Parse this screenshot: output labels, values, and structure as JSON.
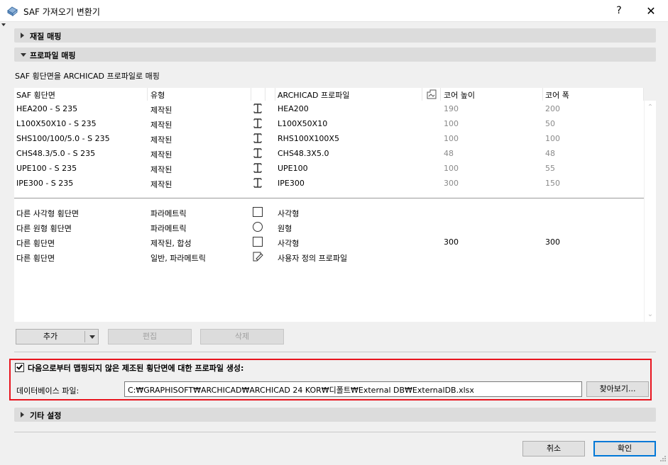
{
  "window": {
    "title": "SAF 가져오기 변환기",
    "help": "?",
    "close": "✕"
  },
  "sections": {
    "material": "재질 매핑",
    "profile": "프로파일 매핑",
    "other": "기타 설정"
  },
  "profile": {
    "subtitle": "SAF 횡단면을 ARCHICAD 프로파일로 매핑",
    "headers": [
      "SAF 횡단면",
      "유형",
      "ARCHICAD 프로파일",
      "코어 높이",
      "코어 폭"
    ],
    "rows": [
      {
        "saf": "HEA200 - S 235",
        "type": "제작된",
        "icon": "i-beam-icon",
        "archicad": "HEA200",
        "h": "190",
        "w": "200"
      },
      {
        "saf": "L100X50X10 - S 235",
        "type": "제작된",
        "icon": "i-beam-icon",
        "archicad": "L100X50X10",
        "h": "100",
        "w": "50"
      },
      {
        "saf": "SHS100/100/5.0 - S 235",
        "type": "제작된",
        "icon": "i-beam-icon",
        "archicad": "RHS100X100X5",
        "h": "100",
        "w": "100"
      },
      {
        "saf": "CHS48.3/5.0 - S 235",
        "type": "제작된",
        "icon": "i-beam-icon",
        "archicad": "CHS48.3X5.0",
        "h": "48",
        "w": "48"
      },
      {
        "saf": "UPE100 - S 235",
        "type": "제작된",
        "icon": "i-beam-icon",
        "archicad": "UPE100",
        "h": "100",
        "w": "55"
      },
      {
        "saf": "IPE300 - S 235",
        "type": "제작된",
        "icon": "i-beam-icon",
        "archicad": "IPE300",
        "h": "300",
        "w": "150"
      }
    ],
    "other_rows": [
      {
        "saf": "다른 사각형 횡단면",
        "type": "파라메트릭",
        "icon": "rectangle-icon",
        "archicad": "사각형",
        "h": "",
        "w": ""
      },
      {
        "saf": "다른 원형 횡단면",
        "type": "파라메트릭",
        "icon": "circle-icon",
        "archicad": "원형",
        "h": "",
        "w": ""
      },
      {
        "saf": "다른 횡단면",
        "type": "제작된, 합성",
        "icon": "rectangle-icon",
        "archicad": "사각형",
        "h": "300",
        "w": "300"
      },
      {
        "saf": "다른 횡단면",
        "type": "일반, 파라메트릭",
        "icon": "custom-profile-icon",
        "archicad": "사용자 정의 프로파일",
        "h": "",
        "w": ""
      }
    ],
    "buttons": {
      "add": "추가",
      "edit": "편집",
      "delete": "삭제"
    }
  },
  "generate": {
    "checked": true,
    "label": "다음으로부터 맵핑되지 않은 제조된 횡단면에 대한 프로파일 생성:",
    "db_label": "데이터베이스 파일:",
    "db_path": "C:₩GRAPHISOFT₩ARCHICAD₩ARCHICAD 24 KOR₩디폴트₩External DB₩ExternalDB.xlsx",
    "browse": "찾아보기..."
  },
  "footer": {
    "cancel": "취소",
    "ok": "확인"
  },
  "colors": {
    "highlight": "#e8141e",
    "section_bar": "#dcdcdc",
    "default_button_border": "#0078d7"
  }
}
